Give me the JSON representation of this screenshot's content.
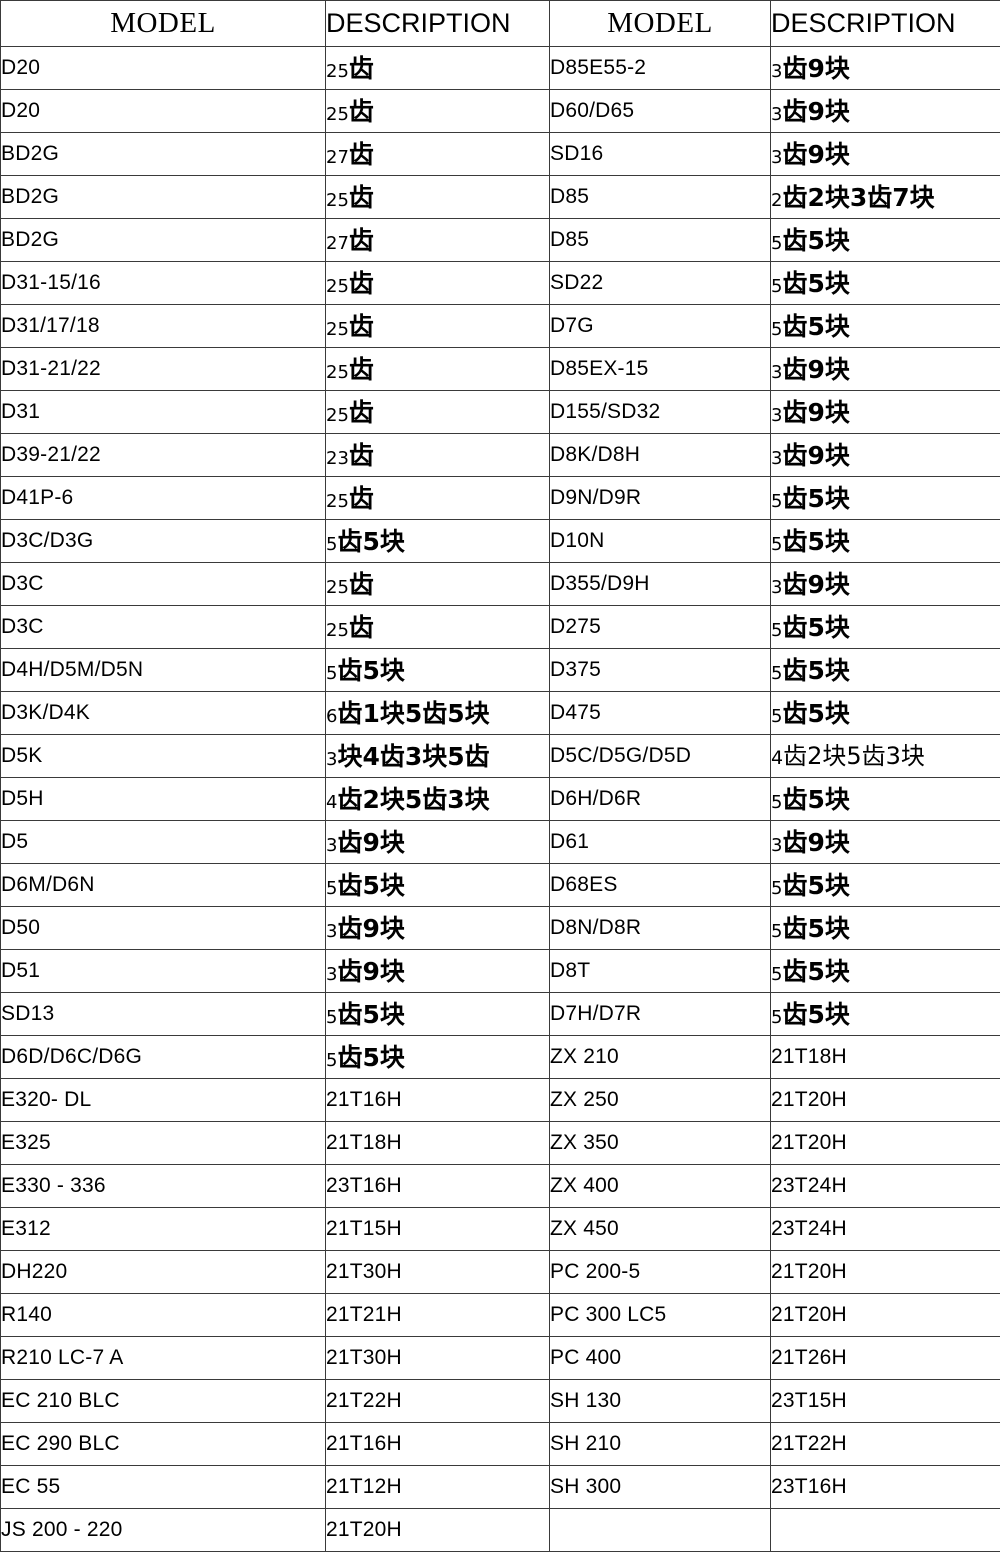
{
  "table": {
    "headers": {
      "model_left": "MODEL",
      "description_left": "DESCRIPTION",
      "model_right": "MODEL",
      "description_right": "DESCRIPTION"
    },
    "rows": [
      {
        "model_left": "D20",
        "desc_left": "25齿",
        "desc_left_lead": "25",
        "desc_left_rest": "齿",
        "desc_left_style": "heavy",
        "model_left_indent": 0,
        "model_right": "D85E55-2",
        "desc_right": "3齿9块",
        "desc_right_lead": "3",
        "desc_right_rest": "齿9块",
        "desc_right_style": "heavy",
        "model_right_indent": 0
      },
      {
        "model_left": "D20",
        "desc_left": "25齿",
        "desc_left_lead": "25",
        "desc_left_rest": "齿",
        "desc_left_style": "heavy",
        "model_left_indent": 0,
        "model_right": "D60/D65",
        "desc_right": "3齿9块",
        "desc_right_lead": "3",
        "desc_right_rest": "齿9块",
        "desc_right_style": "heavy",
        "model_right_indent": 0
      },
      {
        "model_left": "BD2G",
        "desc_left": "27齿",
        "desc_left_lead": "27",
        "desc_left_rest": "齿",
        "desc_left_style": "heavy",
        "model_left_indent": 0,
        "model_right": "SD16",
        "desc_right": "3齿9块",
        "desc_right_lead": "3",
        "desc_right_rest": "齿9块",
        "desc_right_style": "heavy",
        "model_right_indent": 0
      },
      {
        "model_left": "BD2G",
        "desc_left": "25齿",
        "desc_left_lead": "25",
        "desc_left_rest": "齿",
        "desc_left_style": "heavy",
        "model_left_indent": 0,
        "model_right": "D85",
        "desc_right": "2齿2块3齿7块",
        "desc_right_lead": "2",
        "desc_right_rest": "齿2块3齿7块",
        "desc_right_style": "heavy",
        "model_right_indent": 0
      },
      {
        "model_left": "BD2G",
        "desc_left": "27齿",
        "desc_left_lead": "27",
        "desc_left_rest": "齿",
        "desc_left_style": "heavy",
        "model_left_indent": 0,
        "model_right": "D85",
        "desc_right": "5齿5块",
        "desc_right_lead": "5",
        "desc_right_rest": "齿5块",
        "desc_right_style": "heavy",
        "model_right_indent": 0
      },
      {
        "model_left": "D31-15/16",
        "desc_left": "25齿",
        "desc_left_lead": "25",
        "desc_left_rest": "齿",
        "desc_left_style": "heavy",
        "model_left_indent": 0,
        "model_right": "SD22",
        "desc_right": "5齿5块",
        "desc_right_lead": "5",
        "desc_right_rest": "齿5块",
        "desc_right_style": "heavy",
        "model_right_indent": 0
      },
      {
        "model_left": "D31/17/18",
        "desc_left": "25齿",
        "desc_left_lead": "25",
        "desc_left_rest": "齿",
        "desc_left_style": "heavy",
        "model_left_indent": 0,
        "model_right": "D7G",
        "desc_right": "5齿5块",
        "desc_right_lead": "5",
        "desc_right_rest": "齿5块",
        "desc_right_style": "heavy",
        "model_right_indent": 0
      },
      {
        "model_left": "D31-21/22",
        "desc_left": "25齿",
        "desc_left_lead": "25",
        "desc_left_rest": "齿",
        "desc_left_style": "heavy",
        "model_left_indent": 0,
        "model_right": "D85EX-15",
        "desc_right": "3齿9块",
        "desc_right_lead": "3",
        "desc_right_rest": "齿9块",
        "desc_right_style": "heavy",
        "model_right_indent": 0
      },
      {
        "model_left": "D31",
        "desc_left": "25齿",
        "desc_left_lead": "25",
        "desc_left_rest": "齿",
        "desc_left_style": "heavy",
        "model_left_indent": 0,
        "model_right": "D155/SD32",
        "desc_right": "3齿9块",
        "desc_right_lead": "3",
        "desc_right_rest": "齿9块",
        "desc_right_style": "heavy",
        "model_right_indent": 0
      },
      {
        "model_left": "D39-21/22",
        "desc_left": "23齿",
        "desc_left_lead": "23",
        "desc_left_rest": "齿",
        "desc_left_style": "heavy",
        "model_left_indent": 0,
        "model_right": "D8K/D8H",
        "desc_right": "3齿9块",
        "desc_right_lead": "3",
        "desc_right_rest": "齿9块",
        "desc_right_style": "heavy",
        "model_right_indent": 0
      },
      {
        "model_left": "D41P-6",
        "desc_left": "25齿",
        "desc_left_lead": "25",
        "desc_left_rest": "齿",
        "desc_left_style": "heavy",
        "model_left_indent": 0,
        "model_right": "D9N/D9R",
        "desc_right": "5齿5块",
        "desc_right_lead": "5",
        "desc_right_rest": "齿5块",
        "desc_right_style": "heavy",
        "model_right_indent": 0
      },
      {
        "model_left": "D3C/D3G",
        "desc_left": "5齿5块",
        "desc_left_lead": "5",
        "desc_left_rest": "齿5块",
        "desc_left_style": "heavy",
        "model_left_indent": 0,
        "model_right": "D10N",
        "desc_right": "5齿5块",
        "desc_right_lead": "5",
        "desc_right_rest": "齿5块",
        "desc_right_style": "heavy",
        "model_right_indent": 0
      },
      {
        "model_left": "D3C",
        "desc_left": "25齿",
        "desc_left_lead": "25",
        "desc_left_rest": "齿",
        "desc_left_style": "heavy",
        "model_left_indent": 0,
        "model_right": "D355/D9H",
        "desc_right": "3齿9块",
        "desc_right_lead": "3",
        "desc_right_rest": "齿9块",
        "desc_right_style": "heavy",
        "model_right_indent": 0
      },
      {
        "model_left": "D3C",
        "desc_left": "25齿",
        "desc_left_lead": "25",
        "desc_left_rest": "齿",
        "desc_left_style": "heavy",
        "model_left_indent": 0,
        "model_right": "D275",
        "desc_right": "5齿5块",
        "desc_right_lead": "5",
        "desc_right_rest": "齿5块",
        "desc_right_style": "heavy",
        "model_right_indent": 0
      },
      {
        "model_left": "D4H/D5M/D5N",
        "desc_left": "5齿5块",
        "desc_left_lead": "5",
        "desc_left_rest": "齿5块",
        "desc_left_style": "heavy",
        "model_left_indent": 0,
        "model_right": "D375",
        "desc_right": "5齿5块",
        "desc_right_lead": "5",
        "desc_right_rest": "齿5块",
        "desc_right_style": "heavy",
        "model_right_indent": 0
      },
      {
        "model_left": "D3K/D4K",
        "desc_left": "6齿1块5齿5块",
        "desc_left_lead": "6",
        "desc_left_rest": "齿1块5齿5块",
        "desc_left_style": "heavy",
        "model_left_indent": 0,
        "model_right": "D475",
        "desc_right": "5齿5块",
        "desc_right_lead": "5",
        "desc_right_rest": "齿5块",
        "desc_right_style": "heavy",
        "model_right_indent": 0
      },
      {
        "model_left": "D5K",
        "desc_left": "3块4齿3块5齿",
        "desc_left_lead": "3",
        "desc_left_rest": "块4齿3块5齿",
        "desc_left_style": "heavy",
        "model_left_indent": 0,
        "model_right": "D5C/D5G/D5D",
        "desc_right": "4齿2块5齿3块",
        "desc_right_lead": "4",
        "desc_right_rest": "齿2块5齿3块",
        "desc_right_style": "regular",
        "model_right_indent": 0
      },
      {
        "model_left": "D5H",
        "desc_left": "4齿2块5齿3块",
        "desc_left_lead": "4",
        "desc_left_rest": "齿2块5齿3块",
        "desc_left_style": "heavy",
        "model_left_indent": 0,
        "model_right": "D6H/D6R",
        "desc_right": "5齿5块",
        "desc_right_lead": "5",
        "desc_right_rest": "齿5块",
        "desc_right_style": "heavy",
        "model_right_indent": 0
      },
      {
        "model_left": "D5",
        "desc_left": "3齿9块",
        "desc_left_lead": "3",
        "desc_left_rest": "齿9块",
        "desc_left_style": "heavy",
        "model_left_indent": 0,
        "model_right": "D61",
        "desc_right": "3齿9块",
        "desc_right_lead": "3",
        "desc_right_rest": "齿9块",
        "desc_right_style": "heavy",
        "model_right_indent": 0
      },
      {
        "model_left": "D6M/D6N",
        "desc_left": "5齿5块",
        "desc_left_lead": "5",
        "desc_left_rest": "齿5块",
        "desc_left_style": "heavy",
        "model_left_indent": 0,
        "model_right": "D68ES",
        "desc_right": "5齿5块",
        "desc_right_lead": "5",
        "desc_right_rest": "齿5块",
        "desc_right_style": "heavy",
        "model_right_indent": 0
      },
      {
        "model_left": "D50",
        "desc_left": "3齿9块",
        "desc_left_lead": "3",
        "desc_left_rest": "齿9块",
        "desc_left_style": "heavy",
        "model_left_indent": 0,
        "model_right": "D8N/D8R",
        "desc_right": "5齿5块",
        "desc_right_lead": "5",
        "desc_right_rest": "齿5块",
        "desc_right_style": "heavy",
        "model_right_indent": 0
      },
      {
        "model_left": "D51",
        "desc_left": "3齿9块",
        "desc_left_lead": "3",
        "desc_left_rest": "齿9块",
        "desc_left_style": "heavy",
        "model_left_indent": 0,
        "model_right": "D8T",
        "desc_right": "5齿5块",
        "desc_right_lead": "5",
        "desc_right_rest": "齿5块",
        "desc_right_style": "heavy",
        "model_right_indent": 0
      },
      {
        "model_left": "SD13",
        "desc_left": "5齿5块",
        "desc_left_lead": "5",
        "desc_left_rest": "齿5块",
        "desc_left_style": "heavy",
        "model_left_indent": 0,
        "model_right": "D7H/D7R",
        "desc_right": "5齿5块",
        "desc_right_lead": "5",
        "desc_right_rest": "齿5块",
        "desc_right_style": "heavy",
        "model_right_indent": 0
      },
      {
        "model_left": "D6D/D6C/D6G",
        "desc_left": "5齿5块",
        "desc_left_lead": "5",
        "desc_left_rest": "齿5块",
        "desc_left_style": "heavy",
        "model_left_indent": 0,
        "model_right": "ZX 210",
        "desc_right": "21T18H",
        "desc_right_plain": true,
        "model_right_indent": 1
      },
      {
        "model_left": "E320- DL",
        "desc_left": "21T16H",
        "desc_left_plain": true,
        "model_left_indent": 0,
        "model_right": "ZX 250",
        "desc_right": "21T20H",
        "desc_right_plain": true,
        "model_right_indent": 1
      },
      {
        "model_left": "E325",
        "desc_left": "21T18H",
        "desc_left_plain": true,
        "model_left_indent": 0,
        "model_right": "ZX 350",
        "desc_right": "21T20H",
        "desc_right_plain": true,
        "model_right_indent": 1
      },
      {
        "model_left": "E330 - 336",
        "desc_left": "23T16H",
        "desc_left_plain": true,
        "model_left_indent": 0,
        "model_right": "ZX 400",
        "desc_right": "23T24H",
        "desc_right_plain": true,
        "model_right_indent": 1
      },
      {
        "model_left": "E312",
        "desc_left": "21T15H",
        "desc_left_plain": true,
        "model_left_indent": 0,
        "model_right": "ZX 450",
        "desc_right": "23T24H",
        "desc_right_plain": true,
        "model_right_indent": 1
      },
      {
        "model_left": "DH220",
        "desc_left": "21T30H",
        "desc_left_plain": true,
        "model_left_indent": 0,
        "model_right": "PC 200-5",
        "desc_right": "21T20H",
        "desc_right_plain": true,
        "model_right_indent": 1
      },
      {
        "model_left": "R140",
        "desc_left": "21T21H",
        "desc_left_plain": true,
        "model_left_indent": 0,
        "model_right": "PC 300 LC5",
        "desc_right": "21T20H",
        "desc_right_plain": true,
        "model_right_indent": 1
      },
      {
        "model_left": "R210 LC-7 A",
        "desc_left": "21T30H",
        "desc_left_plain": true,
        "model_left_indent": 0,
        "model_right": "PC 400",
        "desc_right": "21T26H",
        "desc_right_plain": true,
        "model_right_indent": 1
      },
      {
        "model_left": "EC 210 BLC",
        "desc_left": "21T22H",
        "desc_left_plain": true,
        "model_left_indent": 1,
        "model_right": "SH 130",
        "desc_right": "23T15H",
        "desc_right_plain": true,
        "model_right_indent": 1
      },
      {
        "model_left": "EC 290 BLC",
        "desc_left": "21T16H",
        "desc_left_plain": true,
        "model_left_indent": 1,
        "model_right": "SH 210",
        "desc_right": "21T22H",
        "desc_right_plain": true,
        "model_right_indent": 1
      },
      {
        "model_left": "EC 55",
        "desc_left": "21T12H",
        "desc_left_plain": true,
        "model_left_indent": 1,
        "model_right": "SH 300",
        "desc_right": "23T16H",
        "desc_right_plain": true,
        "model_right_indent": 0
      },
      {
        "model_left": "JS 200 - 220",
        "desc_left": "21T20H",
        "desc_left_plain": true,
        "model_left_indent": 1,
        "model_right": "",
        "desc_right": "",
        "desc_right_plain": true,
        "model_right_indent": 0
      }
    ]
  }
}
